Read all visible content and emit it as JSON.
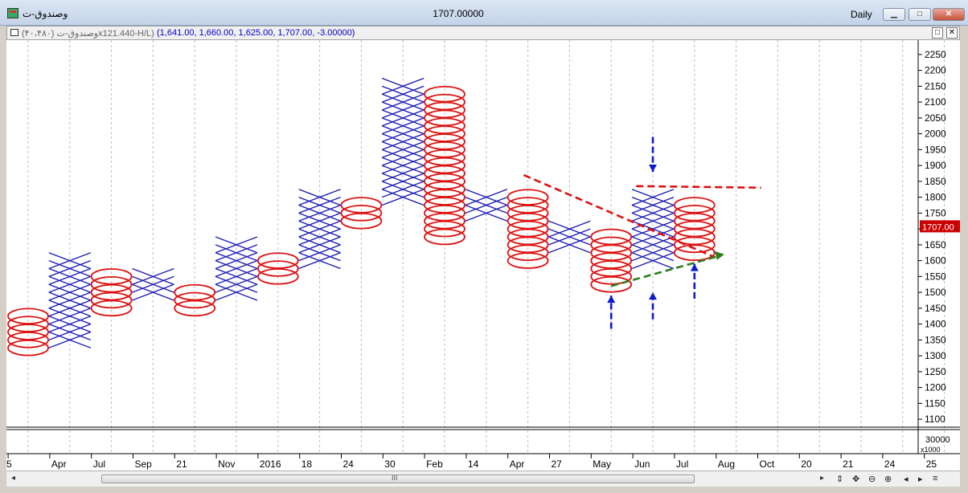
{
  "window": {
    "title": "وصندوق-ت",
    "value": "1707.00000",
    "period": "Daily",
    "min": "▁",
    "max": "□",
    "close": "✕"
  },
  "sub": {
    "symbol": "وصندوق-ت (۴۰،۴۸۰)x121.440-H/L)",
    "values": "(1,641.00, 1,660.00, 1,625.00, 1,707.00, -3.00000)",
    "restore": "□",
    "close": "✕"
  },
  "scroll": {
    "left": "◂",
    "right": "▸",
    "grip": "III"
  },
  "tools": [
    "⇕",
    "✥",
    "⊖",
    "⊕",
    "◂",
    "▸",
    "≡"
  ],
  "colors": {
    "x": "#1c1cb8",
    "o": "#dd1111",
    "grid": "#bdbdbd",
    "price_tag": "#cc0000",
    "green": "#2e7d1e",
    "arrow": "#0a1acc"
  },
  "chart_data": {
    "type": "point_and_figure",
    "box_size": 50,
    "y_axis": {
      "min": 1100,
      "max": 2250,
      "step": 50
    },
    "lower_axis_labels": [
      "30000",
      "x1000"
    ],
    "last_price": "1707.00",
    "x_labels": [
      "5",
      "Apr",
      "Jul",
      "Sep",
      "21",
      "Nov",
      "2016",
      "18",
      "24",
      "30",
      "Feb",
      "14",
      "Apr",
      "27",
      "May",
      "Jun",
      "Jul",
      "Aug",
      "Oct",
      "20",
      "21",
      "24",
      "25"
    ],
    "columns": [
      {
        "type": "O",
        "high": 1425,
        "low": 1325
      },
      {
        "type": "X",
        "low": 1350,
        "high": 1600
      },
      {
        "type": "O",
        "high": 1550,
        "low": 1450
      },
      {
        "type": "X",
        "low": 1500,
        "high": 1550
      },
      {
        "type": "O",
        "high": 1500,
        "low": 1450
      },
      {
        "type": "X",
        "low": 1500,
        "high": 1650
      },
      {
        "type": "O",
        "high": 1600,
        "low": 1550
      },
      {
        "type": "X",
        "low": 1600,
        "high": 1800
      },
      {
        "type": "O",
        "high": 1775,
        "low": 1725
      },
      {
        "type": "X",
        "low": 1800,
        "high": 2150
      },
      {
        "type": "O",
        "high": 2125,
        "low": 1675
      },
      {
        "type": "X",
        "low": 1750,
        "high": 1800
      },
      {
        "type": "O",
        "high": 1800,
        "low": 1600
      },
      {
        "type": "X",
        "low": 1650,
        "high": 1700
      },
      {
        "type": "O",
        "high": 1675,
        "low": 1525
      },
      {
        "type": "X",
        "low": 1600,
        "high": 1800
      },
      {
        "type": "O",
        "high": 1775,
        "low": 1625
      }
    ],
    "annotations": [
      {
        "kind": "trendline",
        "color": "red",
        "from": [
          11.9,
          1870
        ],
        "to": [
          16.5,
          1610
        ]
      },
      {
        "kind": "trendline",
        "color": "red",
        "from": [
          14.6,
          1835
        ],
        "to": [
          17.6,
          1830
        ]
      },
      {
        "kind": "trendline",
        "color": "green",
        "from": [
          14,
          1520
        ],
        "to": [
          16.6,
          1615
        ]
      },
      {
        "kind": "arrow",
        "direction": "up",
        "col": 14,
        "tip": 1490,
        "tail": 1385
      },
      {
        "kind": "arrow",
        "direction": "up",
        "col": 15,
        "tip": 1500,
        "tail": 1415
      },
      {
        "kind": "arrow",
        "direction": "up",
        "col": 16,
        "tip": 1590,
        "tail": 1480
      },
      {
        "kind": "arrow",
        "direction": "down",
        "col": 15,
        "tip": 1880,
        "tail": 1990
      }
    ]
  }
}
